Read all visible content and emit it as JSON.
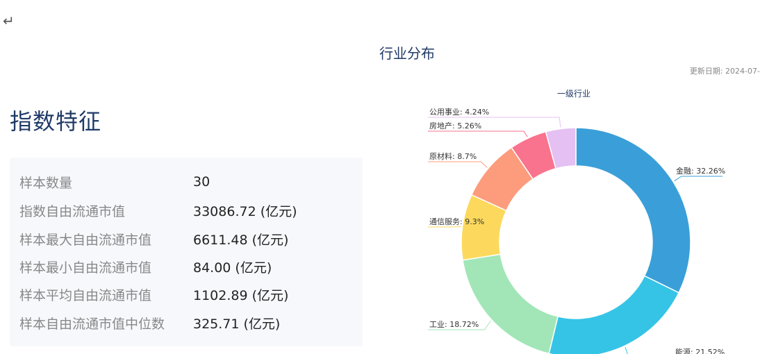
{
  "page": {
    "return_symbol": "↵",
    "section_title": "行业分布",
    "update_date": "更新日期: 2024-07-"
  },
  "index": {
    "title": "指数特征",
    "stats": [
      {
        "label": "样本数量",
        "value": "30"
      },
      {
        "label": "指数自由流通市值",
        "value": "33086.72 (亿元)"
      },
      {
        "label": "样本最大自由流通市值",
        "value": "6611.48 (亿元)"
      },
      {
        "label": "样本最小自由流通市值",
        "value": "84.00 (亿元)"
      },
      {
        "label": "样本平均自由流通市值",
        "value": "1102.89 (亿元)"
      },
      {
        "label": "样本自由流通市值中位数",
        "value": "325.71 (亿元)"
      }
    ]
  },
  "chart_data": {
    "type": "pie",
    "title": "一级行业",
    "donut": true,
    "slices": [
      {
        "name": "金融",
        "value": 32.26,
        "label": "金融: 32.26%",
        "color": "#3a9fd8"
      },
      {
        "name": "能源",
        "value": 21.52,
        "label": "能源: 21.52%",
        "color": "#35c4e6"
      },
      {
        "name": "工业",
        "value": 18.72,
        "label": "工业: 18.72%",
        "color": "#a2e6b8"
      },
      {
        "name": "通信服务",
        "value": 9.3,
        "label": "通信服务: 9.3%",
        "color": "#fcd95c"
      },
      {
        "name": "原材料",
        "value": 8.7,
        "label": "原材料: 8.7%",
        "color": "#fc9c7d"
      },
      {
        "name": "房地产",
        "value": 5.26,
        "label": "房地产: 5.26%",
        "color": "#f9728e"
      },
      {
        "name": "公用事业",
        "value": 4.24,
        "label": "公用事业: 4.24%",
        "color": "#e4c0f3"
      }
    ]
  }
}
